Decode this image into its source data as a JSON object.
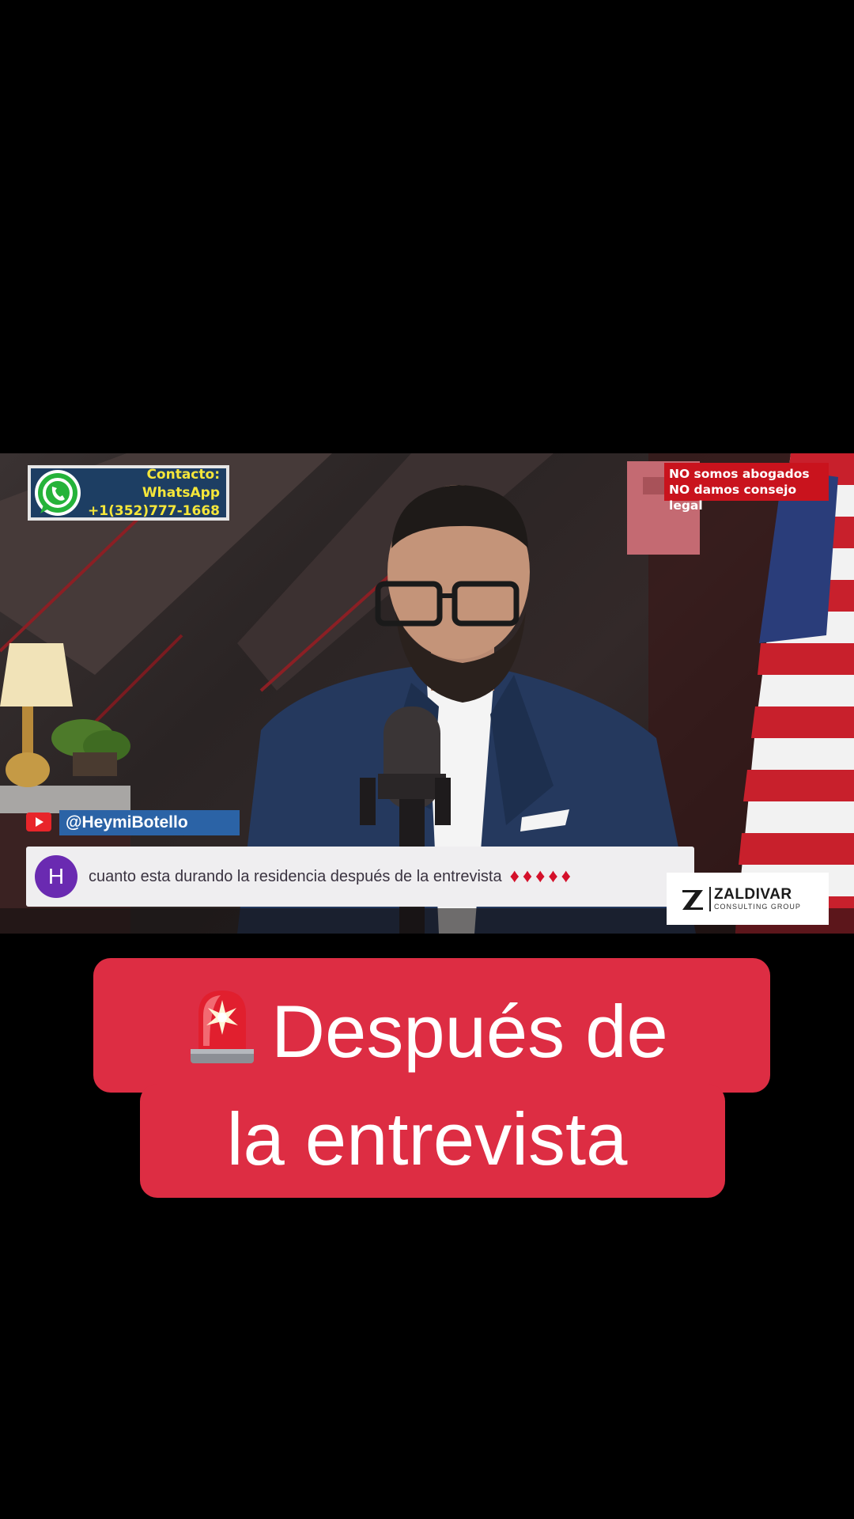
{
  "overlay": {
    "contact_label": "Contacto: WhatsApp",
    "contact_phone": "+1(352)777-1668",
    "disclaimer_line1": "NO somos abogados",
    "disclaimer_line2": "NO damos consejo legal",
    "handle": "@HeymiBotello",
    "comment_avatar_letter": "H",
    "comment_text": "cuanto esta durando la residencia después de la entrevista",
    "comment_emoji": "♦♦♦♦♦",
    "logo_name": "ZALDIVAR",
    "logo_subtitle": "CONSULTING GROUP"
  },
  "caption": {
    "line1": "Después de",
    "line2": "la entrevista"
  },
  "icons": {
    "caption_icon": "police-siren-icon",
    "contact_icon": "whatsapp-icon",
    "channel_icon": "youtube-icon"
  },
  "colors": {
    "caption_bg": "#dd2d43",
    "handle_bg": "#2b63a6",
    "disclaimer_bg": "#c9131d",
    "contact_text": "#f5e63a"
  }
}
